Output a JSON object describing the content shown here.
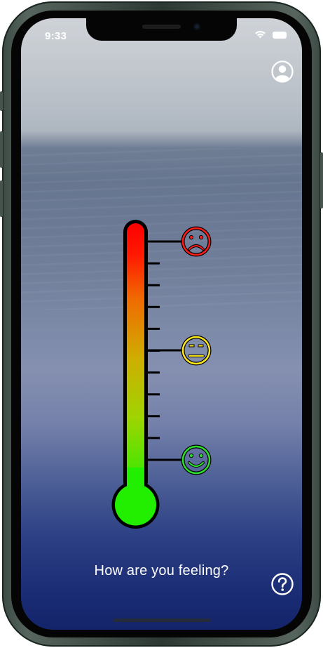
{
  "status_bar": {
    "time": "9:33",
    "wifi_icon": "wifi-icon",
    "battery_icon": "battery-icon"
  },
  "header": {
    "profile_icon": "profile-icon"
  },
  "thermometer": {
    "tick_count": 11,
    "gradient_colors": [
      "#ff0000",
      "#f06a00",
      "#cfae00",
      "#9fd400",
      "#22ee00"
    ],
    "bulb_color": "#22ee00",
    "faces": [
      {
        "mood": "sad",
        "icon": "sad-face-icon",
        "color": "#ff1a1a"
      },
      {
        "mood": "neutral",
        "icon": "neutral-face-icon",
        "color": "#ffe81a"
      },
      {
        "mood": "happy",
        "icon": "happy-face-icon",
        "color": "#2be02b"
      }
    ]
  },
  "prompt": "How are you feeling?",
  "footer": {
    "help_icon": "help-icon"
  }
}
